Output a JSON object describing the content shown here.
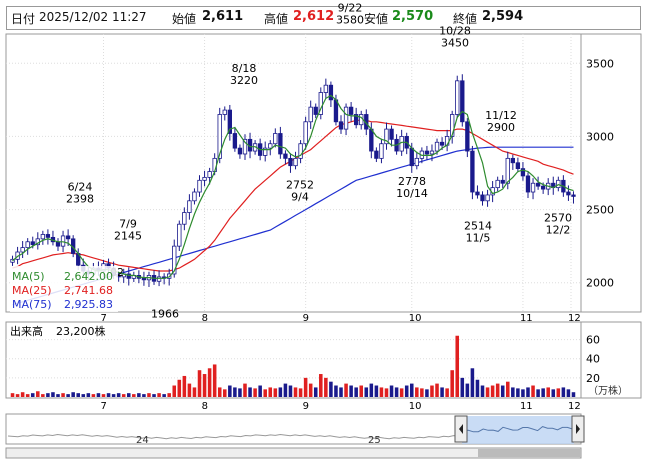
{
  "header": {
    "date_label": "日付",
    "datetime": "2025/12/02 11:27",
    "open_label": "始値",
    "open": "2,611",
    "high_label": "高値",
    "high": "2,612",
    "low_label": "安値",
    "low": "2,570",
    "close_label": "終値",
    "close": "2,594"
  },
  "colors": {
    "candle_up": "#ffffff",
    "candle_down": "#1a1a8c",
    "ma5": "#2e8b2e",
    "ma25": "#e02020",
    "ma75": "#2030d0",
    "volume_up": "#e02020",
    "volume_down": "#1a1a8c",
    "high_value": "#e02020",
    "low_value": "#1a8a1a"
  },
  "legend": {
    "ma5_label": "MA(5)",
    "ma5_value": "2,642.00",
    "ma25_label": "MA(25)",
    "ma25_value": "2,741.68",
    "ma75_label": "MA(75)",
    "ma75_value": "2,925.83"
  },
  "volume": {
    "label": "出来高",
    "value": "23,200株",
    "unit": "（万株）",
    "yticks": [
      "60",
      "40",
      "20"
    ]
  },
  "navigator": {
    "labels": [
      "24",
      "25"
    ]
  },
  "chart_data": {
    "type": "candlestick",
    "x_months": [
      "7",
      "8",
      "9",
      "10",
      "11",
      "12"
    ],
    "y_ticks": [
      2000,
      2500,
      3000,
      3500
    ],
    "ylim": [
      1800,
      3700
    ],
    "annotations": [
      {
        "date": "6/24",
        "value": 2398
      },
      {
        "date": "7/9",
        "value": 2145
      },
      {
        "date": "7/22",
        "value": 1966
      },
      {
        "date": "8/18",
        "value": 3220
      },
      {
        "date": "9/4",
        "value": 2752
      },
      {
        "date": "9/22",
        "value": 3580
      },
      {
        "date": "10/14",
        "value": 2778
      },
      {
        "date": "10/28",
        "value": 3450
      },
      {
        "date": "11/5",
        "value": 2514
      },
      {
        "date": "11/12",
        "value": 2900
      },
      {
        "date": "12/2",
        "value": 2570
      }
    ],
    "partial_label": "02",
    "close": [
      2160,
      2210,
      2240,
      2280,
      2260,
      2300,
      2330,
      2310,
      2280,
      2250,
      2320,
      2300,
      2200,
      2120,
      2080,
      2060,
      2100,
      2080,
      2130,
      2100,
      2050,
      2040,
      2060,
      2030,
      2050,
      2030,
      2020,
      2050,
      2010,
      2040,
      2030,
      2060,
      2250,
      2400,
      2480,
      2560,
      2620,
      2700,
      2720,
      2760,
      2850,
      3150,
      3180,
      3020,
      2920,
      2880,
      2980,
      2900,
      2950,
      2870,
      2920,
      2950,
      3020,
      2880,
      2850,
      2800,
      2850,
      2950,
      3100,
      3200,
      3150,
      3300,
      3350,
      3250,
      3100,
      3050,
      3200,
      3150,
      3080,
      3150,
      3050,
      2900,
      2850,
      2950,
      3050,
      2980,
      2900,
      3000,
      2920,
      2800,
      2850,
      2900,
      2880,
      2900,
      2960,
      2940,
      3000,
      3150,
      3380,
      3100,
      2900,
      2620,
      2600,
      2560,
      2600,
      2650,
      2700,
      2680,
      2850,
      2820,
      2780,
      2730,
      2620,
      2680,
      2660,
      2640,
      2680,
      2650,
      2700,
      2620,
      2600,
      2590
    ],
    "volume": [
      4,
      3,
      5,
      3,
      4,
      6,
      3,
      4,
      5,
      3,
      4,
      3,
      5,
      4,
      3,
      4,
      3,
      4,
      3,
      4,
      3,
      4,
      3,
      4,
      3,
      4,
      3,
      4,
      3,
      4,
      3,
      4,
      12,
      18,
      22,
      14,
      10,
      28,
      24,
      30,
      34,
      10,
      8,
      12,
      10,
      9,
      14,
      10,
      9,
      12,
      8,
      10,
      9,
      10,
      14,
      12,
      10,
      9,
      20,
      14,
      10,
      24,
      20,
      16,
      12,
      10,
      14,
      12,
      10,
      12,
      10,
      14,
      12,
      10,
      9,
      12,
      10,
      9,
      12,
      14,
      10,
      9,
      8,
      12,
      14,
      10,
      9,
      28,
      64,
      20,
      14,
      30,
      18,
      12,
      10,
      12,
      14,
      12,
      16,
      10,
      9,
      8,
      10,
      12,
      8,
      9,
      10,
      8,
      9,
      10,
      8,
      5
    ],
    "ma5": [
      2150,
      2180,
      2200,
      2230,
      2250,
      2270,
      2290,
      2300,
      2290,
      2280,
      2280,
      2270,
      2240,
      2200,
      2150,
      2110,
      2090,
      2080,
      2090,
      2090,
      2080,
      2070,
      2060,
      2050,
      2050,
      2040,
      2035,
      2035,
      2030,
      2030,
      2030,
      2040,
      2080,
      2160,
      2260,
      2370,
      2470,
      2550,
      2620,
      2680,
      2760,
      2880,
      2980,
      3050,
      3060,
      3010,
      2960,
      2930,
      2930,
      2910,
      2910,
      2910,
      2940,
      2930,
      2920,
      2880,
      2860,
      2870,
      2920,
      3000,
      3110,
      3190,
      3260,
      3280,
      3250,
      3190,
      3150,
      3140,
      3140,
      3130,
      3090,
      3050,
      3000,
      2980,
      2970,
      2940,
      2940,
      2960,
      2960,
      2920,
      2890,
      2870,
      2870,
      2870,
      2890,
      2920,
      2940,
      3010,
      3130,
      3170,
      3150,
      3020,
      2920,
      2820,
      2660,
      2610,
      2620,
      2640,
      2690,
      2720,
      2760,
      2770,
      2760,
      2730,
      2690,
      2670,
      2660,
      2650,
      2670,
      2660,
      2640,
      2630
    ],
    "ma25": [
      2100,
      2110,
      2130,
      2140,
      2150,
      2160,
      2170,
      2180,
      2190,
      2195,
      2200,
      2205,
      2200,
      2195,
      2190,
      2180,
      2170,
      2160,
      2150,
      2140,
      2130,
      2120,
      2115,
      2110,
      2105,
      2100,
      2095,
      2090,
      2085,
      2080,
      2080,
      2080,
      2090,
      2100,
      2120,
      2140,
      2160,
      2190,
      2220,
      2250,
      2290,
      2340,
      2390,
      2440,
      2480,
      2520,
      2560,
      2600,
      2640,
      2670,
      2700,
      2730,
      2760,
      2790,
      2810,
      2830,
      2850,
      2870,
      2890,
      2910,
      2940,
      2970,
      3000,
      3030,
      3060,
      3080,
      3090,
      3100,
      3110,
      3110,
      3110,
      3100,
      3100,
      3095,
      3090,
      3085,
      3080,
      3075,
      3070,
      3065,
      3060,
      3055,
      3050,
      3045,
      3040,
      3040,
      3040,
      3040,
      3050,
      3050,
      3040,
      3020,
      3000,
      2980,
      2960,
      2940,
      2920,
      2900,
      2890,
      2880,
      2870,
      2860,
      2850,
      2840,
      2830,
      2810,
      2800,
      2790,
      2780,
      2770,
      2755,
      2742
    ],
    "ma75": [
      1850,
      1860,
      1870,
      1880,
      1890,
      1900,
      1910,
      1920,
      1930,
      1940,
      1950,
      1960,
      1970,
      1980,
      1990,
      2000,
      2010,
      2020,
      2030,
      2040,
      2050,
      2060,
      2070,
      2080,
      2090,
      2100,
      2110,
      2120,
      2130,
      2140,
      2150,
      2160,
      2170,
      2180,
      2190,
      2200,
      2210,
      2220,
      2230,
      2240,
      2250,
      2260,
      2270,
      2280,
      2290,
      2300,
      2310,
      2320,
      2330,
      2340,
      2350,
      2360,
      2380,
      2400,
      2420,
      2440,
      2460,
      2480,
      2500,
      2520,
      2540,
      2560,
      2580,
      2600,
      2620,
      2640,
      2660,
      2680,
      2700,
      2710,
      2720,
      2730,
      2740,
      2750,
      2760,
      2770,
      2780,
      2790,
      2800,
      2810,
      2820,
      2830,
      2840,
      2850,
      2860,
      2870,
      2880,
      2890,
      2900,
      2905,
      2910,
      2915,
      2920,
      2922,
      2925,
      2926,
      2926,
      2926,
      2926,
      2926,
      2926,
      2926,
      2926,
      2926,
      2926,
      2926,
      2926,
      2926,
      2926,
      2926,
      2926,
      2926
    ]
  }
}
